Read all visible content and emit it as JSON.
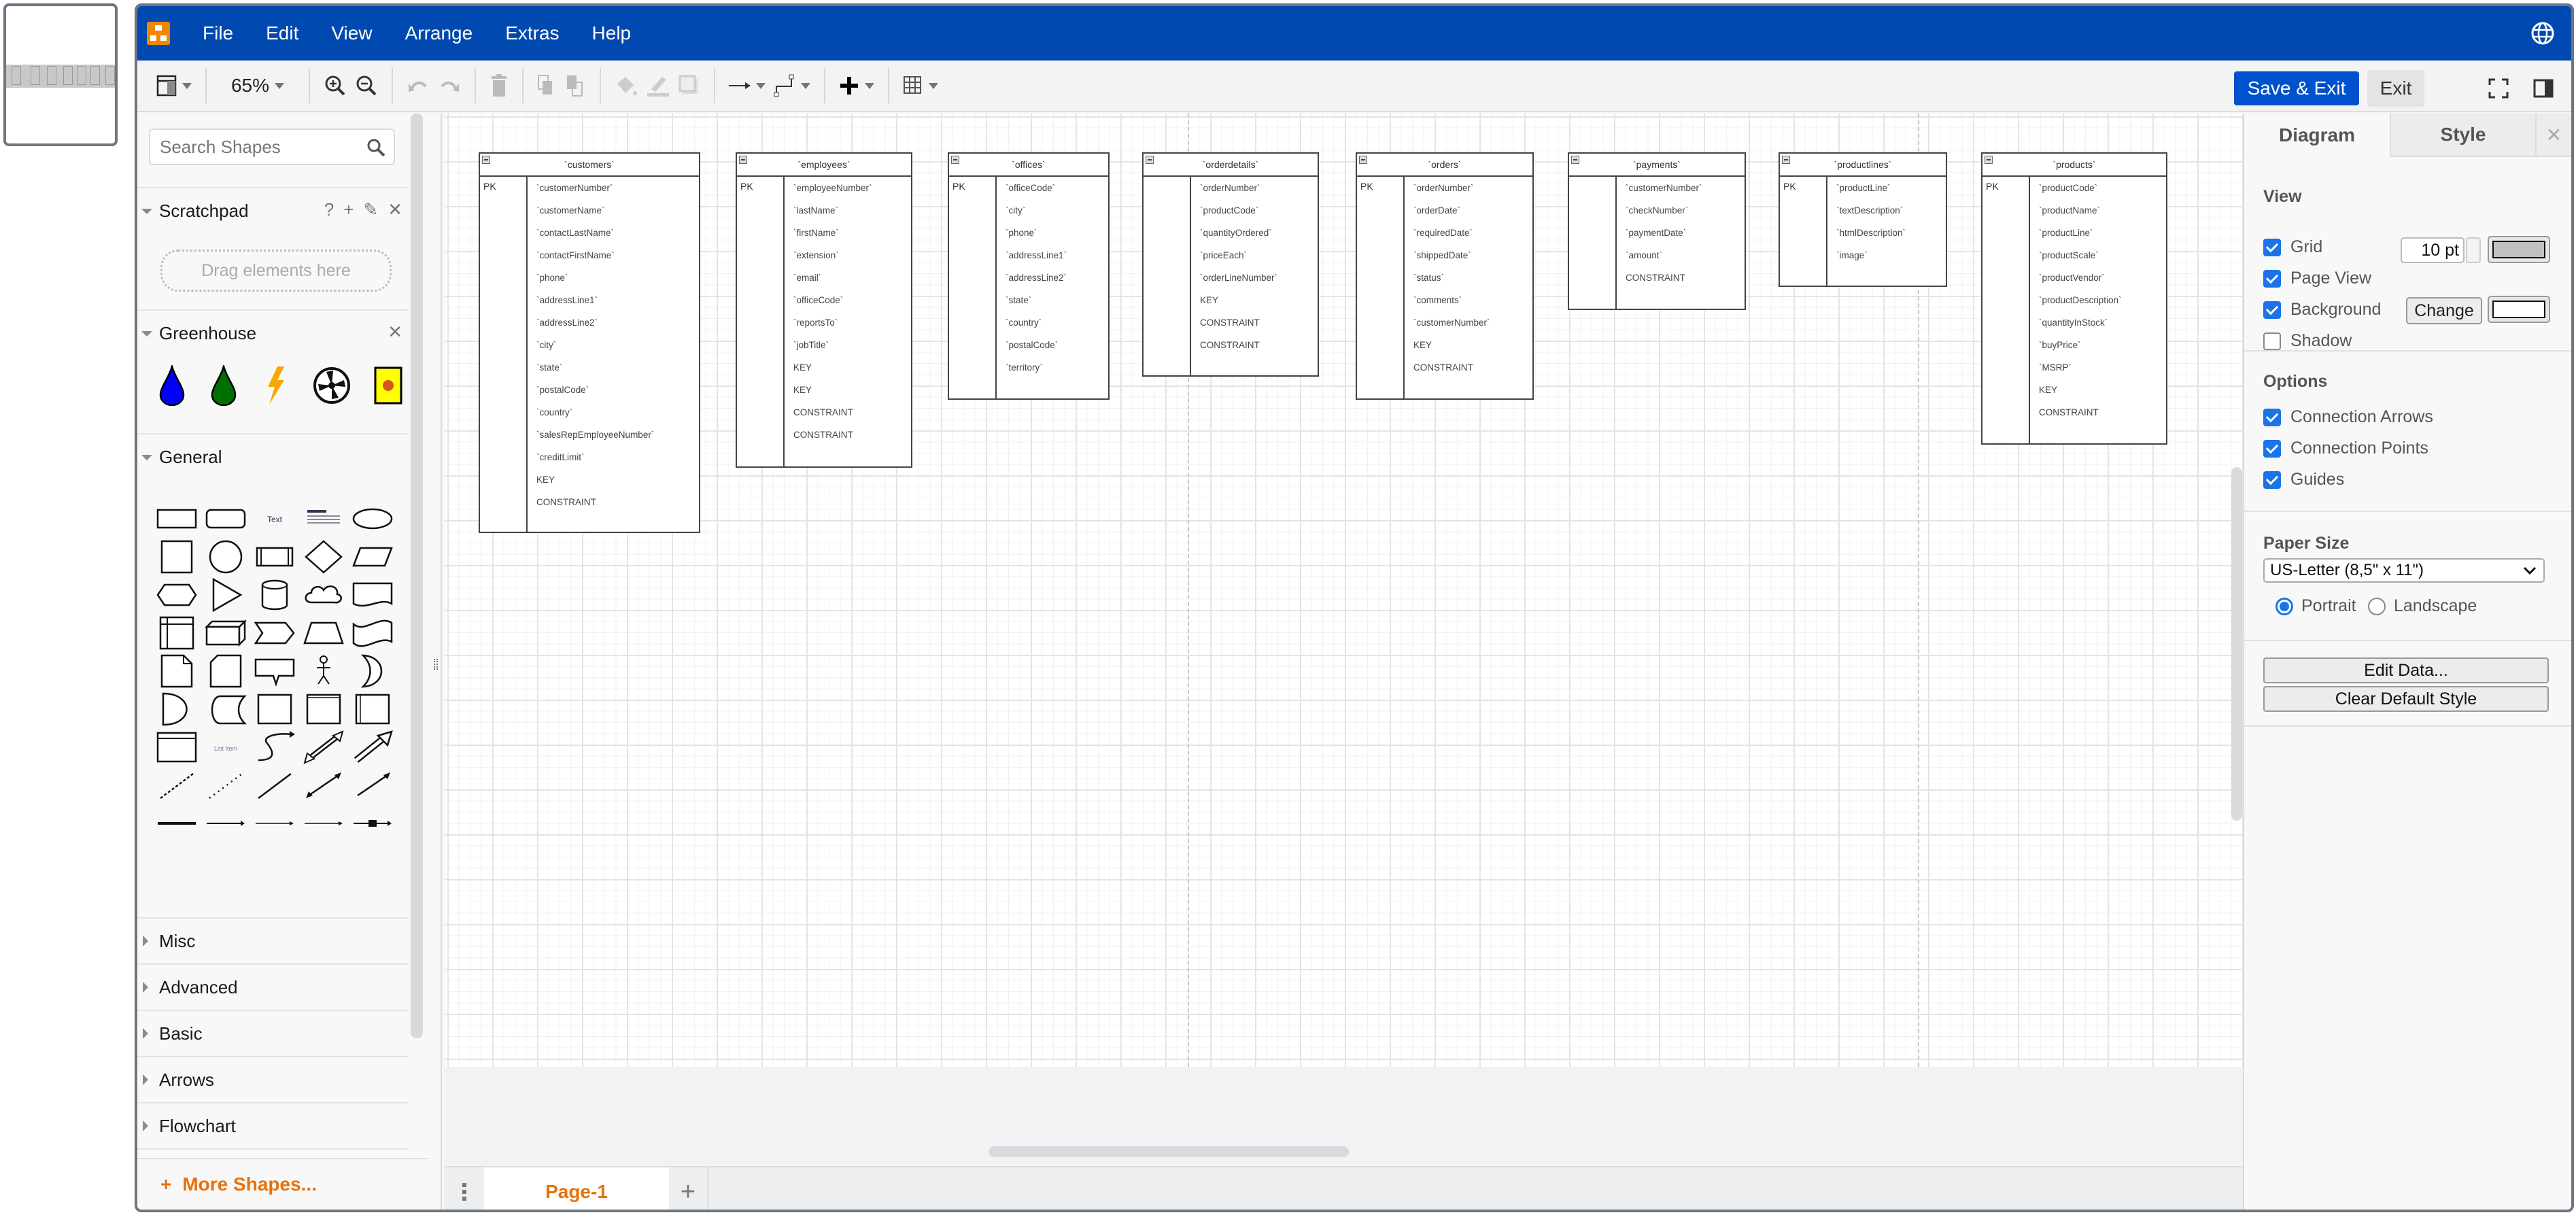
{
  "app": {
    "menu": [
      "File",
      "Edit",
      "View",
      "Arrange",
      "Extras",
      "Help"
    ],
    "brand_color": "#0049b0",
    "accent_color": "#e8710a"
  },
  "toolbar": {
    "zoom": "65%",
    "save_exit_label": "Save & Exit",
    "exit_label": "Exit"
  },
  "sidebar": {
    "search_placeholder": "Search Shapes",
    "scratchpad": {
      "title": "Scratchpad",
      "actions": [
        "?",
        "+",
        "✎",
        "✕"
      ],
      "dropzone": "Drag elements here"
    },
    "greenhouse": {
      "title": "Greenhouse",
      "icons": [
        "blue-water-drop",
        "green-water-drop",
        "lightning-bolt",
        "fan",
        "bug-sign"
      ]
    },
    "general": {
      "title": "General",
      "shapes": [
        "rectangle",
        "rounded-rectangle",
        "text",
        "textbox",
        "ellipse",
        "square",
        "circle",
        "process",
        "diamond",
        "parallelogram",
        "hexagon",
        "triangle",
        "cylinder",
        "cloud",
        "document",
        "internal-storage",
        "cube",
        "step",
        "trapezoid",
        "tape",
        "note",
        "card",
        "callout",
        "actor",
        "or",
        "and",
        "data-storage",
        "container",
        "frame",
        "swimlane",
        "list",
        "list-item",
        "curve",
        "bidirectional-arrow",
        "arrow",
        "dashed-line",
        "dotted-line",
        "line",
        "bidirectional-connector",
        "directional-connector",
        "link",
        "connector-with-label",
        "connector-with-2-labels",
        "connector-with-3-labels",
        "connector-with-symbol"
      ],
      "text_shape_label": "Text",
      "list_item_label": "List Item"
    },
    "collapsed_sections": [
      "Misc",
      "Advanced",
      "Basic",
      "Arrows",
      "Flowchart"
    ],
    "more_shapes": "More Shapes..."
  },
  "diagram": {
    "tables": [
      {
        "name": "`customers`",
        "pk": "PK",
        "rows": [
          "`customerNumber`",
          "`customerName`",
          "`contactLastName`",
          "`contactFirstName`",
          "`phone`",
          "`addressLine1`",
          "`addressLine2`",
          "`city`",
          "`state`",
          "`postalCode`",
          "`country`",
          "`salesRepEmployeeNumber`",
          "`creditLimit`",
          "KEY",
          "CONSTRAINT"
        ]
      },
      {
        "name": "`employees`",
        "pk": "PK",
        "rows": [
          "`employeeNumber`",
          "`lastName`",
          "`firstName`",
          "`extension`",
          "`email`",
          "`officeCode`",
          "`reportsTo`",
          "`jobTitle`",
          "KEY",
          "KEY",
          "CONSTRAINT",
          "CONSTRAINT"
        ]
      },
      {
        "name": "`offices`",
        "pk": "PK",
        "rows": [
          "`officeCode`",
          "`city`",
          "`phone`",
          "`addressLine1`",
          "`addressLine2`",
          "`state`",
          "`country`",
          "`postalCode`",
          "`territory`"
        ]
      },
      {
        "name": "`orderdetails`",
        "pk": "",
        "rows": [
          "`orderNumber`",
          "`productCode`",
          "`quantityOrdered`",
          "`priceEach`",
          "`orderLineNumber`",
          "KEY",
          "CONSTRAINT",
          "CONSTRAINT"
        ]
      },
      {
        "name": "`orders`",
        "pk": "PK",
        "rows": [
          "`orderNumber`",
          "`orderDate`",
          "`requiredDate`",
          "`shippedDate`",
          "`status`",
          "`comments`",
          "`customerNumber`",
          "KEY",
          "CONSTRAINT"
        ]
      },
      {
        "name": "`payments`",
        "pk": "",
        "rows": [
          "`customerNumber`",
          "`checkNumber`",
          "`paymentDate`",
          "`amount`",
          "CONSTRAINT"
        ]
      },
      {
        "name": "`productlines`",
        "pk": "PK",
        "rows": [
          "`productLine`",
          "`textDescription`",
          "`htmlDescription`",
          "`image`"
        ]
      },
      {
        "name": "`products`",
        "pk": "PK",
        "rows": [
          "`productCode`",
          "`productName`",
          "`productLine`",
          "`productScale`",
          "`productVendor`",
          "`productDescription`",
          "`quantityInStock`",
          "`buyPrice`",
          "`MSRP`",
          "KEY",
          "CONSTRAINT"
        ]
      }
    ]
  },
  "pages": {
    "tabs": [
      "Page-1"
    ],
    "active": "Page-1"
  },
  "format_panel": {
    "tabs": [
      "Diagram",
      "Style"
    ],
    "active_tab": "Diagram",
    "view": {
      "title": "View",
      "grid": {
        "label": "Grid",
        "checked": true,
        "size": "10 pt",
        "color": "#c0c0c0"
      },
      "page_view": {
        "label": "Page View",
        "checked": true
      },
      "background": {
        "label": "Background",
        "checked": true,
        "button": "Change",
        "color": "#ffffff"
      },
      "shadow": {
        "label": "Shadow",
        "checked": false
      }
    },
    "options": {
      "title": "Options",
      "connection_arrows": {
        "label": "Connection Arrows",
        "checked": true
      },
      "connection_points": {
        "label": "Connection Points",
        "checked": true
      },
      "guides": {
        "label": "Guides",
        "checked": true
      }
    },
    "paper": {
      "title": "Paper Size",
      "selected": "US-Letter (8,5\" x 11\")",
      "orientation": [
        "Portrait",
        "Landscape"
      ],
      "orientation_selected": "Portrait"
    },
    "edit_data": "Edit Data...",
    "clear_default_style": "Clear Default Style"
  }
}
